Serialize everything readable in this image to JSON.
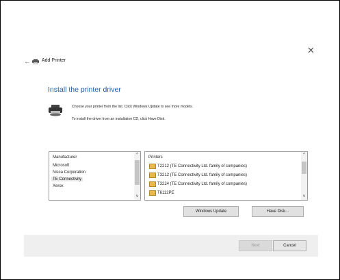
{
  "window": {
    "title": "Add Printer",
    "close_glyph": "✕",
    "back_glyph": "←"
  },
  "main": {
    "heading": "Install the printer driver",
    "description_line1": "Choose your printer from the list. Click Windows Update to see more models.",
    "description_line2": "To install the driver from an installation CD, click Have Disk."
  },
  "manufacturer_list": {
    "header": "Manufacturer",
    "items": [
      "Microsoft",
      "Nisca Corporation",
      "TE Connectivity",
      "Xerox"
    ],
    "selected": "TE Connectivity"
  },
  "printer_list": {
    "header": "Printers",
    "items": [
      "T2212 (TE Connectivity Ltd. family of companies)",
      "T3212 (TE Connectivity Ltd. family of companies)",
      "T3224 (TE Connectivity Ltd. family of companies)",
      "T6112PE"
    ]
  },
  "buttons": {
    "windows_update": "Windows Update",
    "have_disk": "Have Disk...",
    "next": "Next",
    "cancel": "Cancel"
  },
  "icons": {
    "back": "back-arrow-icon",
    "printer_small": "printer-icon",
    "printer_large": "printer-cd-icon",
    "close": "close-icon",
    "printer_item": "printer-item-icon"
  },
  "colors": {
    "heading": "#1c5ea8",
    "footer_bg": "#efefef",
    "icon_folder": "#e8b84a"
  }
}
